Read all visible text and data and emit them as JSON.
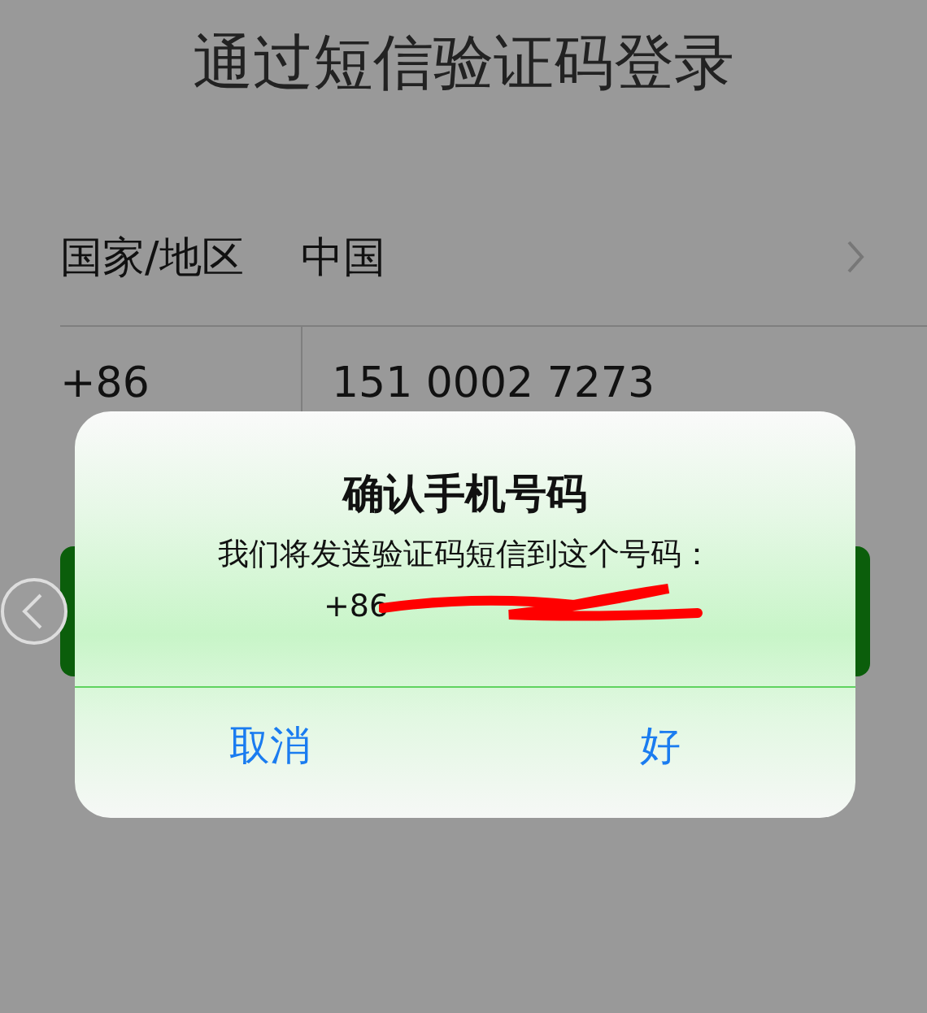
{
  "title": "通过短信验证码登录",
  "form_rows": [
    {
      "kind": "select",
      "label": "国家/地区",
      "value": "中国"
    },
    {
      "kind": "input",
      "label": "+86",
      "value": "151 0002 7273"
    }
  ],
  "dialog": {
    "title": "确认手机号码",
    "message": "我们将发送验证码短信到这个号码：",
    "phone_prefix": "+86",
    "buttons": [
      {
        "label": "取消"
      },
      {
        "label": "好"
      }
    ]
  }
}
